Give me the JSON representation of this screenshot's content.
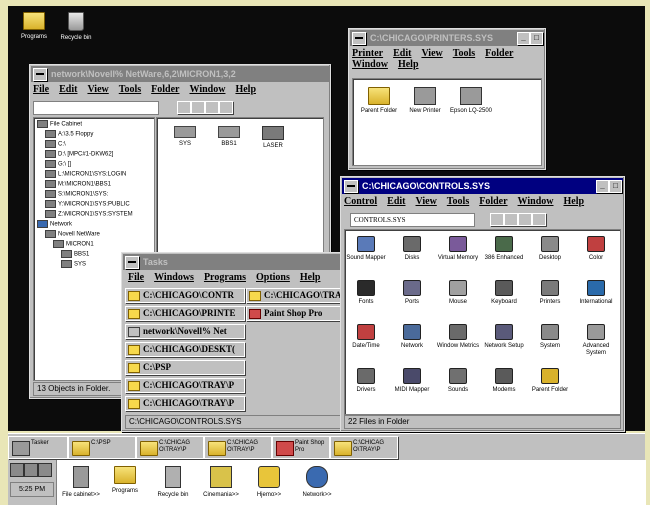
{
  "desktop": {
    "icons": [
      {
        "label": "Programs",
        "icon": "folder-icon"
      },
      {
        "label": "Recycle bin",
        "icon": "recycle-bin-icon"
      }
    ]
  },
  "netware_window": {
    "title": "network\\Novell% NetWare,6,2\\MICRON1,3,2",
    "menu": [
      "File",
      "Edit",
      "View",
      "Tools",
      "Folder",
      "Window",
      "Help"
    ],
    "tree": [
      "File Cabinet",
      "A:\\3.5 Floppy",
      "C:\\",
      "D:\\ [MPC#1-DKW62]",
      "G:\\ []",
      "L:\\MICRON1\\SYS:LOGIN",
      "M:\\MICRON1\\BBS1",
      "S:\\MICRON1\\SYS:",
      "Y:\\MICRON1\\SYS:PUBLIC",
      "Z:\\MICRON1\\SYS:SYSTEM",
      "Network",
      "Novell NetWare",
      "MICRON1",
      "BBS1",
      "SYS"
    ],
    "items": [
      "SYS",
      "BBS1",
      "LASER"
    ],
    "status": "13 Objects in Folder."
  },
  "printers_window": {
    "title": "C:\\CHICAGO\\PRINTERS.SYS",
    "menu": [
      "Printer",
      "Edit",
      "View",
      "Tools",
      "Folder",
      "Window",
      "Help"
    ],
    "items": [
      "Parent Folder",
      "New Printer",
      "Epson LQ-2500"
    ]
  },
  "controls_window": {
    "title": "C:\\CHICAGO\\CONTROLS.SYS",
    "menu": [
      "Control",
      "Edit",
      "View",
      "Tools",
      "Folder",
      "Window",
      "Help"
    ],
    "combo": "CONTROLS.SYS",
    "items": [
      "Sound Mapper",
      "Disks",
      "Virtual Memory",
      "386 Enhanced",
      "Desktop",
      "Color",
      "Fonts",
      "Ports",
      "Mouse",
      "Keyboard",
      "Printers",
      "International",
      "Date/Time",
      "Network",
      "Window Metrics",
      "Network Setup",
      "System",
      "Advanced System",
      "Drivers",
      "MIDI Mapper",
      "Sounds",
      "Modems",
      "Parent Folder"
    ],
    "status": "22 Files in Folder"
  },
  "tasks_window": {
    "title": "Tasks",
    "menu": [
      "File",
      "Windows",
      "Programs",
      "Options",
      "Help"
    ],
    "col1": [
      "C:\\CHICAGO\\CONTR",
      "C:\\CHICAGO\\PRINTE",
      "network\\Novell% Net",
      "C:\\CHICAGO\\DESKT(",
      "C:\\PSP",
      "C:\\CHICAGO\\TRAY\\P",
      "C:\\CHICAGO\\TRAY\\P"
    ],
    "col2": [
      "C:\\CHICAGO\\TRA",
      "Paint Shop Pro"
    ],
    "status": "C:\\CHICAGO\\CONTROLS.SYS"
  },
  "taskbar": {
    "buttons": [
      {
        "label": "Tasker"
      },
      {
        "label": "C:\\PSP"
      },
      {
        "label": "C:\\CHICAG O\\TRAY\\P"
      },
      {
        "label": "C:\\CHICAG O\\TRAY\\P"
      },
      {
        "label": "Paint Shop Pro"
      },
      {
        "label": "C:\\CHICAG O\\TRAY\\P"
      }
    ]
  },
  "tray": {
    "clock": "5:25 PM",
    "launchers": [
      "File cabinet>>",
      "Programs",
      "Recycle bin",
      "Cinemania>>",
      "Hjemo>>",
      "Network>>"
    ]
  },
  "colors": {
    "titlebar_active": "#000080",
    "desktop_bg": "#0c0c0c",
    "window_face": "#c0c0c0"
  }
}
